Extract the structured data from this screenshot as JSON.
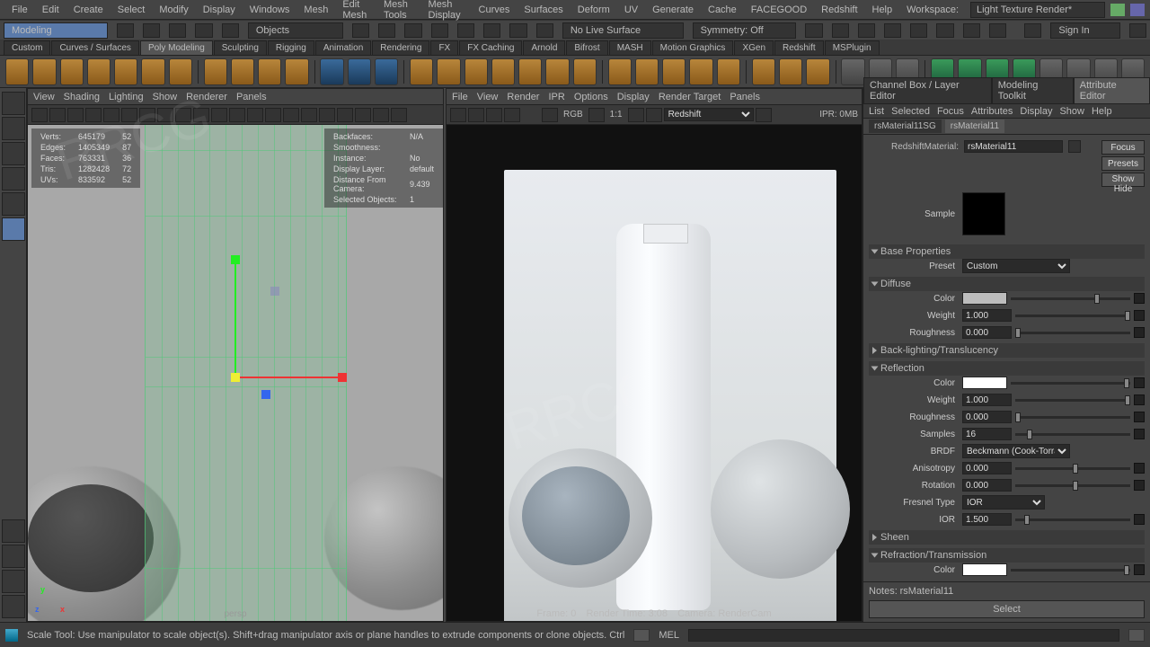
{
  "menubar": [
    "File",
    "Edit",
    "Create",
    "Select",
    "Modify",
    "Display",
    "Windows",
    "Mesh",
    "Edit Mesh",
    "Mesh Tools",
    "Mesh Display",
    "Curves",
    "Surfaces",
    "Deform",
    "UV",
    "Generate",
    "Cache",
    "FACEGOOD",
    "Redshift",
    "Help"
  ],
  "workspace_label": "Workspace:",
  "workspace_value": "Light Texture Render*",
  "status": {
    "mode": "Modeling",
    "search_ph": "",
    "objects": "Objects",
    "symmetry": "Symmetry: Off",
    "livesurf": "No Live Surface",
    "signin": "Sign In"
  },
  "shelf_tabs": [
    "Custom",
    "Curves / Surfaces",
    "Poly Modeling",
    "Sculpting",
    "Rigging",
    "Animation",
    "Rendering",
    "FX",
    "FX Caching",
    "Arnold",
    "Bifrost",
    "MASH",
    "Motion Graphics",
    "XGen",
    "Redshift",
    "MSPlugin"
  ],
  "shelf_active": "Poly Modeling",
  "vp_left": {
    "menus": [
      "View",
      "Shading",
      "Lighting",
      "Show",
      "Renderer",
      "Panels"
    ],
    "hud": {
      "Verts": [
        "645179",
        "52"
      ],
      "Edges": [
        "1405349",
        "87"
      ],
      "Faces": [
        "763331",
        "36"
      ],
      "Tris": [
        "1282428",
        "72"
      ],
      "UVs": [
        "833592",
        "52"
      ]
    },
    "hud2": {
      "Backfaces": "N/A",
      "Smoothness": "",
      "Instance": "No",
      "Display Layer": "default",
      "Distance From Camera": "9.439",
      "Selected Objects": "1"
    },
    "camera": "persp"
  },
  "vp_right": {
    "menus": [
      "File",
      "View",
      "Render",
      "IPR",
      "Options",
      "Display",
      "Render Target",
      "Panels"
    ],
    "toolbar": {
      "colorspace": "RGB",
      "scale": "1:1",
      "renderer": "Redshift",
      "ipr": "IPR: 0MB"
    },
    "footer": {
      "frame": "Frame: 0",
      "time": "Render Time: 3:08",
      "cam": "Camera: RenderCam"
    }
  },
  "ae": {
    "tabs_top": [
      "Channel Box / Layer Editor",
      "Modeling Toolkit",
      "Attribute Editor"
    ],
    "subs": [
      "List",
      "Selected",
      "Focus",
      "Attributes",
      "Display",
      "Show",
      "Help"
    ],
    "mat_tabs": [
      "rsMaterial11SG",
      "rsMaterial11"
    ],
    "type_label": "RedshiftMaterial:",
    "type_value": "rsMaterial11",
    "buttons": [
      "Focus",
      "Presets",
      "Show  Hide"
    ],
    "sample_label": "Sample",
    "sections": {
      "base": "Base Properties",
      "preset_lbl": "Preset",
      "preset_val": "Custom",
      "diffuse": "Diffuse",
      "backlight": "Back-lighting/Translucency",
      "reflection": "Reflection",
      "sheen": "Sheen",
      "refraction": "Refraction/Transmission"
    },
    "diffuse": {
      "color": "#bdbdbd",
      "weight": "1.000",
      "roughness": "0.000"
    },
    "reflection": {
      "color": "#ffffff",
      "weight": "1.000",
      "roughness": "0.000",
      "samples": "16",
      "brdf": "Beckmann (Cook-Torrance)",
      "aniso": "0.000",
      "rotation": "0.000",
      "fresnel": "IOR",
      "ior": "1.500"
    },
    "refraction_color": "#ffffff",
    "notes_lbl": "Notes:",
    "notes_val": "rsMaterial11",
    "select": "Select"
  },
  "bottom": {
    "help": "Scale Tool: Use manipulator to scale object(s). Shift+drag manipulator axis or plane handles to extrude components or clone objects. Ctrl+Shift+LMB+drag to constrain scaling to connected edges.",
    "script": "MEL"
  },
  "labels": {
    "color": "Color",
    "weight": "Weight",
    "roughness": "Roughness",
    "samples": "Samples",
    "brdf": "BRDF",
    "aniso": "Anisotropy",
    "rotation": "Rotation",
    "fresnel": "Fresnel Type",
    "ior": "IOR"
  }
}
